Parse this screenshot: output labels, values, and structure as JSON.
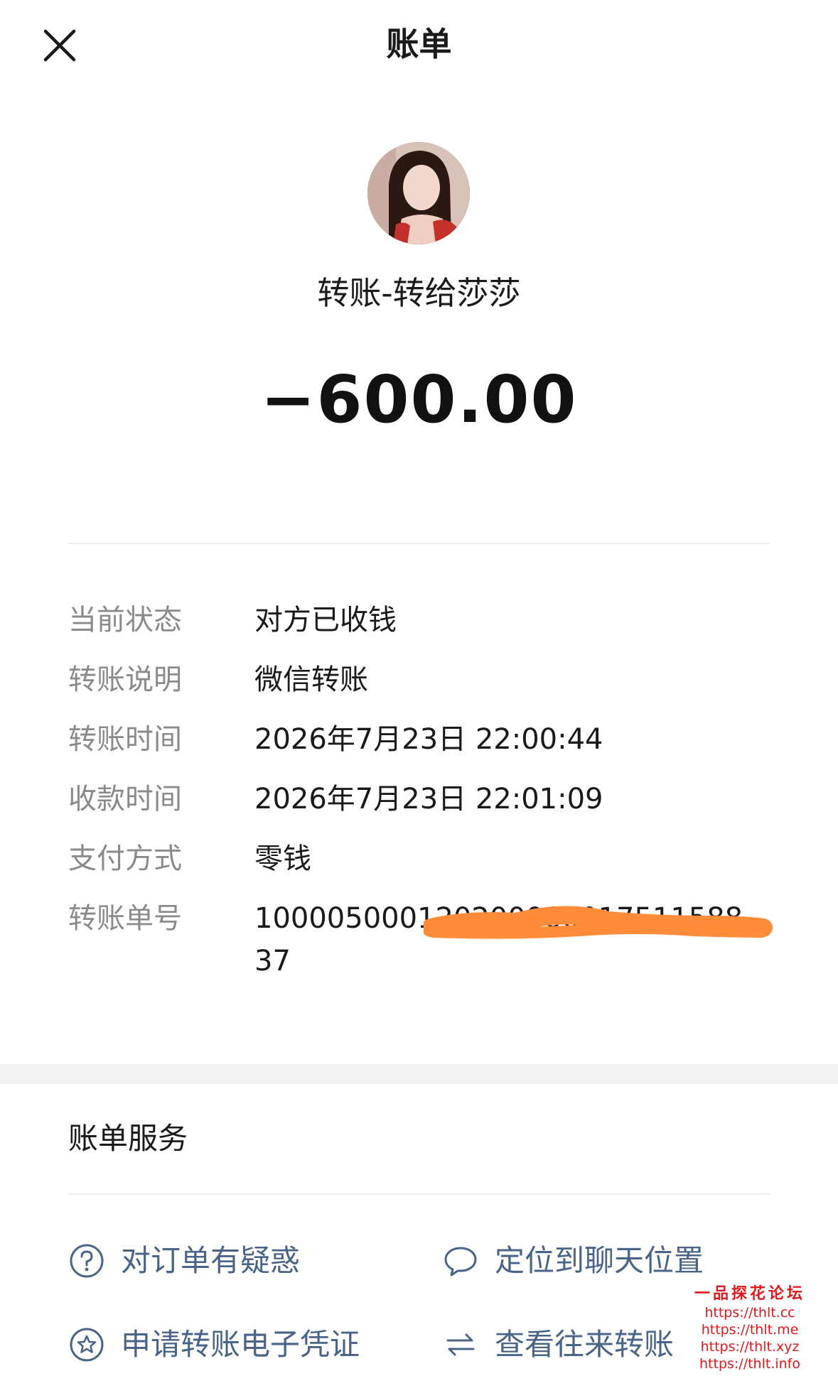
{
  "header": {
    "title": "账单",
    "close_icon": "close-icon"
  },
  "hero": {
    "avatar_icon": "avatar",
    "transfer_title": "转账-转给莎莎",
    "amount": "−600.00"
  },
  "details": [
    {
      "label": "当前状态",
      "value": "对方已收钱"
    },
    {
      "label": "转账说明",
      "value": "微信转账"
    },
    {
      "label": "转账时间",
      "value": "2026年7月23日 22:00:44"
    },
    {
      "label": "收款时间",
      "value": "2026年7月23日 22:01:09"
    },
    {
      "label": "支付方式",
      "value": "零钱"
    },
    {
      "label": "转账单号",
      "value": "100005000120200000017511588 37"
    }
  ],
  "services": {
    "title": "账单服务",
    "items": [
      {
        "label": "对订单有疑惑",
        "icon": "question-circle-icon"
      },
      {
        "label": "定位到聊天位置",
        "icon": "chat-bubble-icon"
      },
      {
        "label": "申请转账电子凭证",
        "icon": "star-circle-icon"
      },
      {
        "label": "查看往来转账",
        "icon": "transfer-arrows-icon"
      }
    ]
  },
  "watermark": {
    "title": "一品探花论坛",
    "urls": [
      "https://thlt.cc",
      "https://thlt.me",
      "https://thlt.xyz",
      "https://thlt.info"
    ]
  },
  "colors": {
    "label_gray": "#8a8a8a",
    "link_blue": "#4a6488",
    "divider": "#ececec",
    "section_gap": "#f2f2f2",
    "redaction_orange": "#ff8c3a",
    "watermark_red": "#e0191c"
  }
}
